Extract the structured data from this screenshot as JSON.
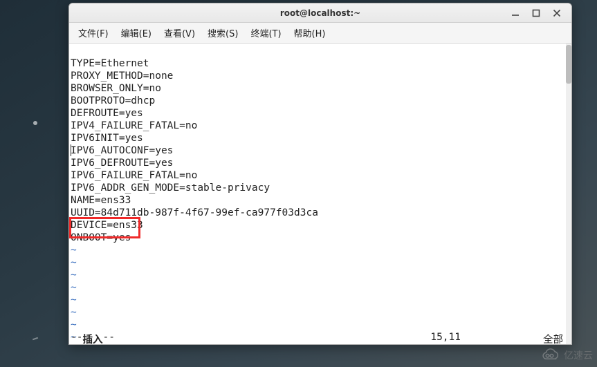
{
  "window": {
    "title": "root@localhost:~"
  },
  "menu": {
    "file": "文件(F)",
    "edit": "编辑(E)",
    "view": "查看(V)",
    "search": "搜索(S)",
    "terminal": "终端(T)",
    "help": "帮助(H)"
  },
  "config_lines": [
    "TYPE=Ethernet",
    "PROXY_METHOD=none",
    "BROWSER_ONLY=no",
    "BOOTPROTO=dhcp",
    "DEFROUTE=yes",
    "IPV4_FAILURE_FATAL=no",
    "IPV6INIT=yes",
    "IPV6_AUTOCONF=yes",
    "IPV6_DEFROUTE=yes",
    "IPV6_FAILURE_FATAL=no",
    "IPV6_ADDR_GEN_MODE=stable-privacy",
    "NAME=ens33",
    "UUID=84d711db-987f-4f67-99ef-ca977f03d3ca",
    "DEVICE=ens33",
    "ONBOOT=yes"
  ],
  "vim": {
    "tilde": "~",
    "mode_prefix": "-- ",
    "mode": "插入",
    "mode_suffix": " --",
    "cursor_position": "15,11",
    "scroll_percent": "全部"
  },
  "watermark": {
    "text": "亿速云"
  }
}
